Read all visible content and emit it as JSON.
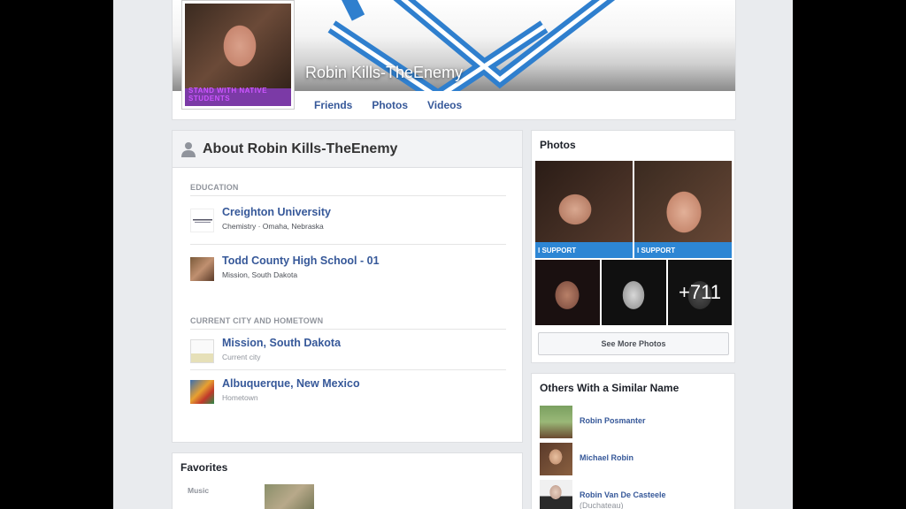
{
  "profile": {
    "name": "Robin Kills-TheEnemy",
    "pic_banner": "STAND WITH NATIVE STUDENTS"
  },
  "tabs": [
    {
      "label": "Friends"
    },
    {
      "label": "Photos"
    },
    {
      "label": "Videos"
    }
  ],
  "about": {
    "title": "About Robin Kills-TheEnemy",
    "education_label": "EDUCATION",
    "education": [
      {
        "title": "Creighton University",
        "subtitle": "Chemistry · Omaha, Nebraska"
      },
      {
        "title": "Todd County High School - 01",
        "subtitle": "Mission, South Dakota"
      }
    ],
    "places_label": "CURRENT CITY AND HOMETOWN",
    "places": [
      {
        "title": "Mission, South Dakota",
        "subtitle": "Current city"
      },
      {
        "title": "Albuquerque, New Mexico",
        "subtitle": "Hometown"
      }
    ]
  },
  "favorites": {
    "title": "Favorites",
    "music_label": "Music"
  },
  "photos": {
    "title": "Photos",
    "support_text": "I SUPPORT",
    "more_count": "+711",
    "see_more": "See More Photos"
  },
  "others": {
    "title": "Others With a Similar Name",
    "people": [
      {
        "name": "Robin Posmanter",
        "sub": ""
      },
      {
        "name": "Michael Robin",
        "sub": ""
      },
      {
        "name": "Robin Van De Casteele",
        "sub": "(Duchateau)"
      }
    ]
  },
  "colors": {
    "link": "#365899",
    "page_bg": "#e9ebee",
    "support_blue": "#2d86d4",
    "cover_logo_blue": "#2f7fce"
  }
}
